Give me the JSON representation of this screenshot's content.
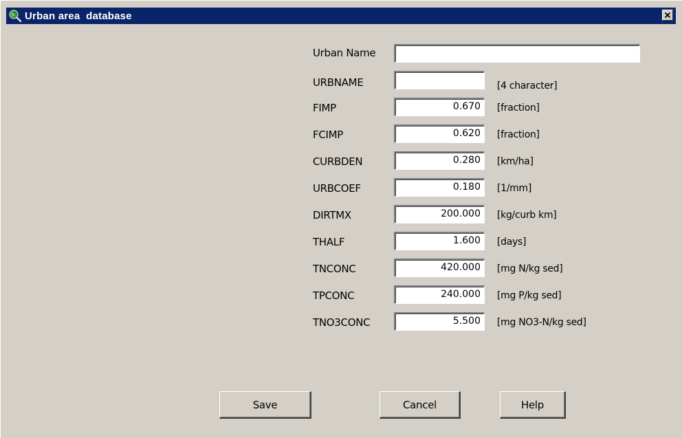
{
  "window": {
    "title": "Urban area  database",
    "icon": "globe-magnifier-icon",
    "close_icon": "close-icon",
    "colors": {
      "titlebar": "#0a246a",
      "face": "#d4d0c8"
    }
  },
  "form": {
    "urban_name": {
      "label": "Urban Name",
      "value": ""
    },
    "fields": [
      {
        "label": "URBNAME",
        "value": "",
        "unit": "[4 character]"
      },
      {
        "label": "FIMP",
        "value": "0.670",
        "unit": "[fraction]"
      },
      {
        "label": "FCIMP",
        "value": "0.620",
        "unit": "[fraction]"
      },
      {
        "label": "CURBDEN",
        "value": "0.280",
        "unit": "[km/ha]"
      },
      {
        "label": "URBCOEF",
        "value": "0.180",
        "unit": "[1/mm]"
      },
      {
        "label": "DIRTMX",
        "value": "200.000",
        "unit": "[kg/curb km]"
      },
      {
        "label": "THALF",
        "value": "1.600",
        "unit": "[days]"
      },
      {
        "label": "TNCONC",
        "value": "420.000",
        "unit": "[mg N/kg sed]"
      },
      {
        "label": "TPCONC",
        "value": "240.000",
        "unit": "[mg P/kg sed]"
      },
      {
        "label": "TNO3CONC",
        "value": "5.500",
        "unit": "[mg NO3-N/kg sed]"
      }
    ]
  },
  "buttons": {
    "save": "Save",
    "cancel": "Cancel",
    "help": "Help"
  }
}
